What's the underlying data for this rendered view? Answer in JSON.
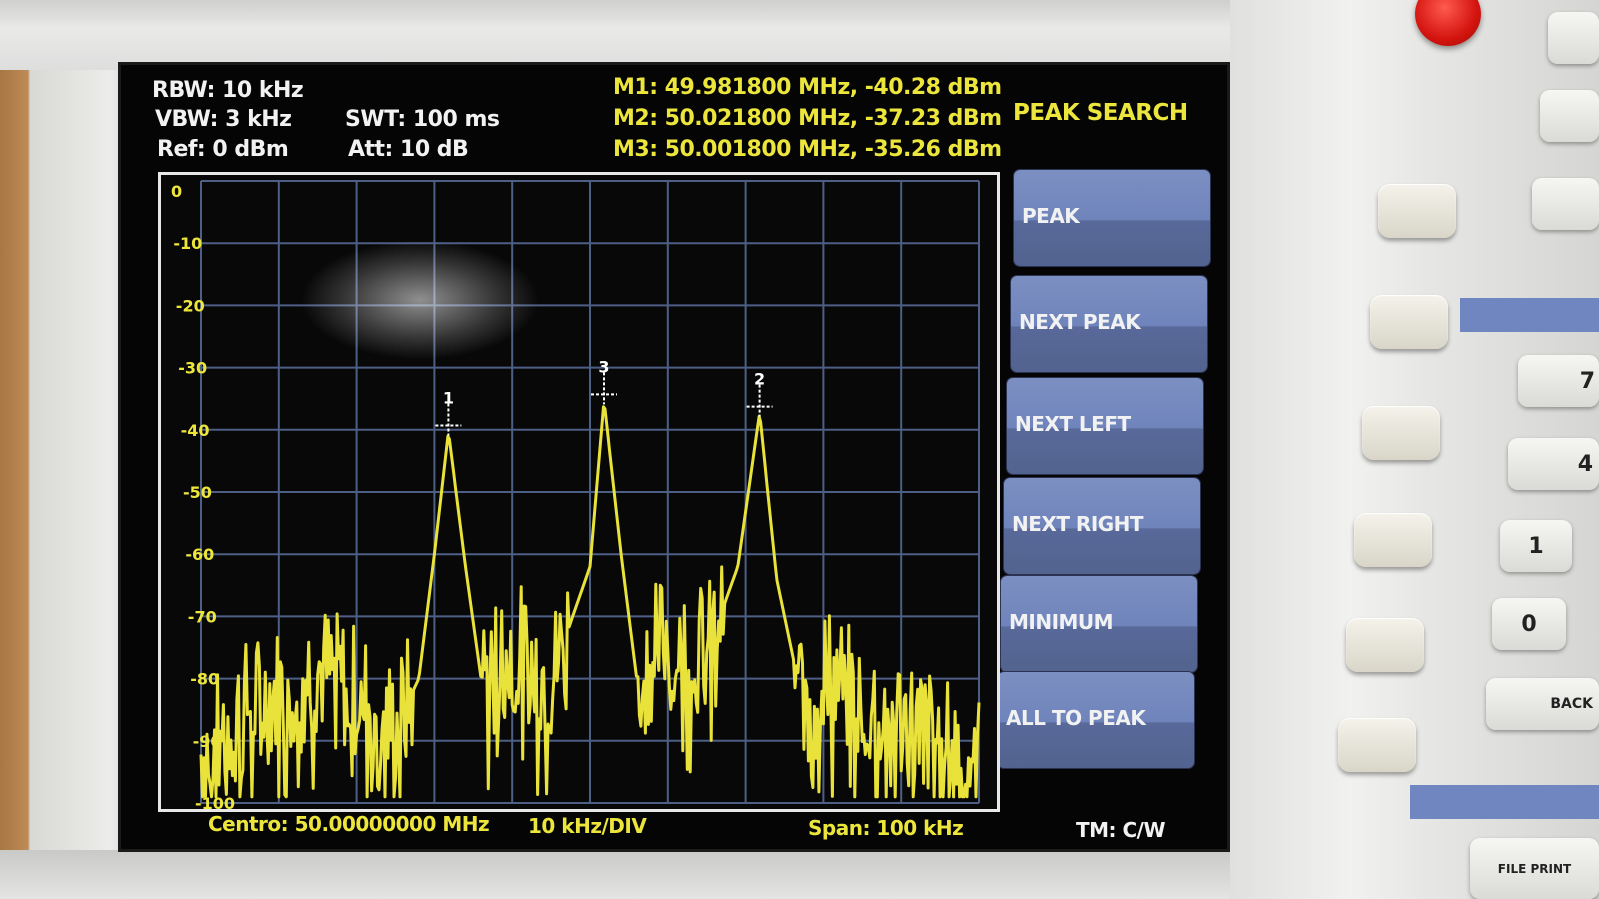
{
  "header": {
    "rbw": "RBW: 10 kHz",
    "vbw": "VBW: 3 kHz",
    "ref": "Ref: 0 dBm",
    "swt": "SWT: 100 ms",
    "att": "Att: 10 dB",
    "markers": [
      "M1: 49.981800 MHz, -40.28 dBm",
      "M2: 50.021800 MHz, -37.23 dBm",
      "M3: 50.001800 MHz, -35.26 dBm"
    ]
  },
  "menu": {
    "title": "PEAK SEARCH",
    "softkeys": [
      "PEAK",
      "NEXT PEAK",
      "NEXT LEFT",
      "NEXT RIGHT",
      "MINIMUM",
      "ALL TO PEAK"
    ]
  },
  "footer": {
    "center": "Centro: 50.00000000 MHz",
    "div": "10 kHz/DIV",
    "span": "Span: 100 kHz",
    "mode": "TM: C/W"
  },
  "keypad": {
    "keys": [
      "7",
      "4",
      "1",
      "0",
      "BACK",
      "FILE PRINT"
    ]
  },
  "chart_data": {
    "type": "line",
    "title": "",
    "xlabel": "",
    "ylabel": "",
    "xlim": [
      49.95,
      50.05
    ],
    "ylim": [
      -100,
      0
    ],
    "y_ticks": [
      "0",
      "-10",
      "-20",
      "-30",
      "-40",
      "-50",
      "-60",
      "-70",
      "-80",
      "-90",
      "-100"
    ],
    "grid": true,
    "colors": {
      "trace": "#e8e23a",
      "grid": "#4e5f86",
      "tick": "#ece63c"
    },
    "series": [
      {
        "x": [
          49.95,
          49.955,
          49.96,
          49.965,
          49.97,
          49.975,
          49.978,
          49.98,
          49.9818,
          49.984,
          49.986,
          49.99,
          49.995,
          50.0,
          50.0018,
          50.004,
          50.006,
          50.01,
          50.015,
          50.019,
          50.0218,
          50.024,
          50.027,
          50.03,
          50.035,
          50.04,
          50.045,
          50.05
        ],
        "y": [
          -92,
          -85,
          -82,
          -78,
          -82,
          -88,
          -80,
          -60,
          -40.28,
          -62,
          -80,
          -74,
          -80,
          -62,
          -35.26,
          -60,
          -80,
          -72,
          -76,
          -62,
          -37.23,
          -64,
          -82,
          -78,
          -84,
          -86,
          -90,
          -93
        ]
      }
    ],
    "markers": [
      {
        "label": "1",
        "x": 49.9818,
        "y": -40.28
      },
      {
        "label": "2",
        "x": 50.0218,
        "y": -37.23
      },
      {
        "label": "3",
        "x": 50.0018,
        "y": -35.26
      }
    ]
  }
}
